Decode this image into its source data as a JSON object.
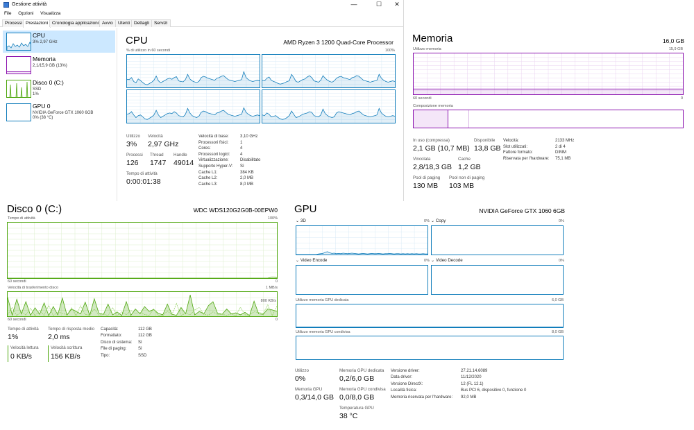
{
  "window": {
    "title": "Gestione attività",
    "menu": [
      "File",
      "Opzioni",
      "Visualizza"
    ],
    "tabs": [
      "Processi",
      "Prestazioni",
      "Cronologia applicazioni",
      "Avvio",
      "Utenti",
      "Dettagli",
      "Servizi"
    ],
    "active_tab": "Prestazioni"
  },
  "sidebar": {
    "items": [
      {
        "name": "CPU",
        "sub1": "3% 2,97 GHz",
        "sub2": ""
      },
      {
        "name": "Memoria",
        "sub1": "2,1/15,9 GB (13%)",
        "sub2": ""
      },
      {
        "name": "Disco 0 (C:)",
        "sub1": "SSD",
        "sub2": "1%"
      },
      {
        "name": "GPU 0",
        "sub1": "NVIDIA GeForce GTX 1060 6GB",
        "sub2": "0% (38 °C)"
      }
    ]
  },
  "cpu": {
    "title": "CPU",
    "model": "AMD Ryzen 3 1200 Quad-Core Processor",
    "graph_label": "% di utilizzo in 60 secondi",
    "graph_max": "100%",
    "utilizzo_label": "Utilizzo",
    "utilizzo": "3%",
    "velocita_label": "Velocità",
    "velocita": "2,97 GHz",
    "processi_label": "Processi",
    "processi": "126",
    "thread_label": "Thread",
    "thread": "1747",
    "handle_label": "Handle",
    "handle": "49014",
    "uptime_label": "Tempo di attività",
    "uptime": "0:00:01:38",
    "specs": [
      {
        "k": "Velocità di base:",
        "v": "3,10 GHz"
      },
      {
        "k": "Processori fisici:",
        "v": "1"
      },
      {
        "k": "Cores:",
        "v": "4"
      },
      {
        "k": "Processori logici:",
        "v": "4"
      },
      {
        "k": "Virtualizzazione:",
        "v": "Disabilitato"
      },
      {
        "k": "Supporto Hyper-V:",
        "v": "Sì"
      },
      {
        "k": "Cache L1:",
        "v": "384 KB"
      },
      {
        "k": "Cache L2:",
        "v": "2,0 MB"
      },
      {
        "k": "Cache L3:",
        "v": "8,0 MB"
      }
    ],
    "cores_usage": [
      [
        25,
        24,
        30,
        18,
        14,
        26,
        21,
        15,
        10,
        8,
        12,
        16,
        22,
        35,
        20,
        14,
        18,
        22,
        26,
        28,
        25,
        30,
        33,
        20,
        18,
        17,
        24,
        40,
        26,
        20,
        17,
        15,
        18,
        30,
        34,
        32,
        28,
        26,
        24,
        22,
        28,
        30,
        34,
        36,
        30,
        24,
        22,
        20,
        18,
        20,
        22,
        24,
        48,
        30,
        24,
        20,
        18,
        20,
        22,
        20
      ],
      [
        22,
        20,
        28,
        32,
        22,
        18,
        16,
        12,
        10,
        12,
        14,
        18,
        20,
        40,
        30,
        18,
        16,
        20,
        24,
        26,
        32,
        36,
        30,
        20,
        18,
        16,
        22,
        36,
        28,
        22,
        18,
        16,
        20,
        28,
        32,
        34,
        30,
        28,
        26,
        24,
        30,
        32,
        36,
        34,
        28,
        22,
        20,
        18,
        16,
        18,
        20,
        22,
        40,
        28,
        22,
        18,
        16,
        18,
        20,
        18
      ],
      [
        26,
        28,
        34,
        24,
        16,
        22,
        24,
        18,
        12,
        10,
        14,
        18,
        24,
        38,
        24,
        16,
        20,
        24,
        28,
        30,
        28,
        34,
        30,
        22,
        20,
        18,
        26,
        44,
        30,
        22,
        18,
        16,
        20,
        32,
        36,
        34,
        30,
        28,
        26,
        24,
        30,
        32,
        36,
        38,
        32,
        26,
        24,
        22,
        20,
        22,
        24,
        26,
        46,
        32,
        26,
        22,
        20,
        22,
        24,
        22
      ],
      [
        24,
        22,
        30,
        26,
        18,
        20,
        22,
        16,
        12,
        10,
        12,
        16,
        22,
        36,
        26,
        16,
        18,
        22,
        26,
        28,
        30,
        34,
        32,
        22,
        20,
        18,
        24,
        42,
        28,
        22,
        18,
        16,
        18,
        30,
        34,
        32,
        30,
        28,
        26,
        24,
        28,
        30,
        34,
        36,
        30,
        24,
        22,
        20,
        18,
        20,
        22,
        24,
        44,
        30,
        24,
        20,
        18,
        20,
        22,
        20
      ]
    ]
  },
  "memory": {
    "title": "Memoria",
    "total": "16,0 GB",
    "graph_label": "Utilizzo memoria",
    "graph_max": "15,9 GB",
    "time_label": "60 secondi",
    "zero": "0",
    "comp_label": "Composizione memoria",
    "in_use_fraction": 0.13,
    "stats": {
      "inuso_label": "In uso (compressa)",
      "inuso": "2,1 GB (10,7 MB)",
      "disp_label": "Disponibile",
      "disp": "13,8 GB",
      "vinc_label": "Vincolata",
      "vinc": "2,8/18,3 GB",
      "cache_label": "Cache",
      "cache": "1,2 GB",
      "pool_label": "Pool di paging",
      "pool": "130 MB",
      "npool_label": "Pool non di paging",
      "npool": "103 MB"
    },
    "specs": [
      {
        "k": "Velocità:",
        "v": "2133 MHz"
      },
      {
        "k": "Slot utilizzati:",
        "v": "2 di 4"
      },
      {
        "k": "Fattore formato:",
        "v": "DIMM"
      },
      {
        "k": "Riservata per l'hardware:",
        "v": "75,1 MB"
      }
    ]
  },
  "disk": {
    "title": "Disco 0 (C:)",
    "model": "WDC WDS120G2G0B-00EPW0",
    "graph1_label": "Tempo di attività",
    "graph1_max": "100%",
    "graph2_label": "Velocità di trasferimento disco",
    "graph2_max": "1 MB/s",
    "graph2_mid": "800 KB/s",
    "time_label": "60 secondi",
    "zero": "0",
    "active_label": "Tempo di attività",
    "active": "1%",
    "resp_label": "Tempo di risposta medio",
    "resp": "2,0 ms",
    "read_label": "Velocità lettura",
    "read": "0 KB/s",
    "write_label": "Velocità scrittura",
    "write": "156 KB/s",
    "specs": [
      {
        "k": "Capacità:",
        "v": "112 GB"
      },
      {
        "k": "Formattato:",
        "v": "112 GB"
      },
      {
        "k": "Disco di sistema:",
        "v": "Sì"
      },
      {
        "k": "File di paging:",
        "v": "Sì"
      },
      {
        "k": "Tipo:",
        "v": "SSD"
      }
    ],
    "activity": [
      0,
      0,
      0,
      0,
      0,
      0,
      0,
      0,
      0,
      0,
      0,
      0,
      0,
      0,
      0,
      0,
      0,
      0,
      0,
      0,
      0,
      0,
      0,
      0,
      0,
      0,
      0,
      0,
      0,
      0,
      0,
      0,
      0,
      0,
      0,
      0,
      0,
      0,
      0,
      0,
      0,
      0,
      0,
      0,
      0,
      0,
      0,
      0,
      0,
      0,
      0,
      0,
      0,
      0,
      0,
      0,
      0,
      0,
      2,
      1
    ],
    "transfer": [
      78,
      5,
      70,
      10,
      60,
      4,
      35,
      8,
      55,
      3,
      40,
      6,
      75,
      5,
      30,
      20,
      10,
      58,
      4,
      72,
      12,
      8,
      50,
      6,
      18,
      3,
      60,
      4,
      30,
      10,
      40,
      20,
      28,
      12,
      6,
      50,
      8,
      4,
      36,
      10,
      88,
      6,
      20,
      10,
      44,
      60,
      12,
      8,
      30,
      10,
      14,
      6,
      16,
      3,
      62,
      10,
      8,
      30,
      26,
      20
    ]
  },
  "gpu": {
    "title": "GPU",
    "model": "NVIDIA GeForce GTX 1060 6GB",
    "engines": [
      {
        "name": "3D",
        "pct": "0%"
      },
      {
        "name": "Copy",
        "pct": "0%"
      },
      {
        "name": "Video Encode",
        "pct": "0%"
      },
      {
        "name": "Video Decode",
        "pct": "0%"
      }
    ],
    "usage_3d": [
      0,
      0,
      0,
      0,
      0,
      0,
      0,
      0,
      0,
      0,
      2,
      3,
      4,
      8,
      10,
      6,
      4,
      5,
      3,
      4,
      3,
      5,
      4,
      3,
      4,
      5,
      4,
      3,
      2,
      3,
      4,
      3,
      2,
      3,
      4,
      3,
      3,
      4,
      3,
      2,
      3,
      3,
      4,
      3,
      2,
      3,
      3,
      2,
      3,
      2,
      3,
      2,
      3,
      2,
      3,
      2,
      2,
      3,
      2,
      2
    ],
    "dedicated_label": "Utilizzo memoria GPU dedicata",
    "dedicated_max": "6,0 GB",
    "shared_label": "Utilizzo memoria GPU condivisa",
    "shared_max": "8,0 GB",
    "util_label": "Utilizzo",
    "util": "0%",
    "ded_label": "Memoria GPU dedicata",
    "ded": "0,2/6,0 GB",
    "mem_label": "Memoria GPU",
    "mem": "0,3/14,0 GB",
    "sh_label": "Memoria GPU condivisa",
    "sh": "0,0/8,0 GB",
    "temp_label": "Temperatura GPU",
    "temp": "38 °C",
    "specs": [
      {
        "k": "Versione driver:",
        "v": "27.21.14.6089"
      },
      {
        "k": "Data driver:",
        "v": "11/12/2020"
      },
      {
        "k": "Versione DirectX:",
        "v": "12 (FL 12.1)"
      },
      {
        "k": "Località fisica:",
        "v": "Bus PCI 6, dispositivo 0, funzione 0"
      },
      {
        "k": "Memoria riservata per l'hardware:",
        "v": "92,0 MB"
      }
    ]
  }
}
